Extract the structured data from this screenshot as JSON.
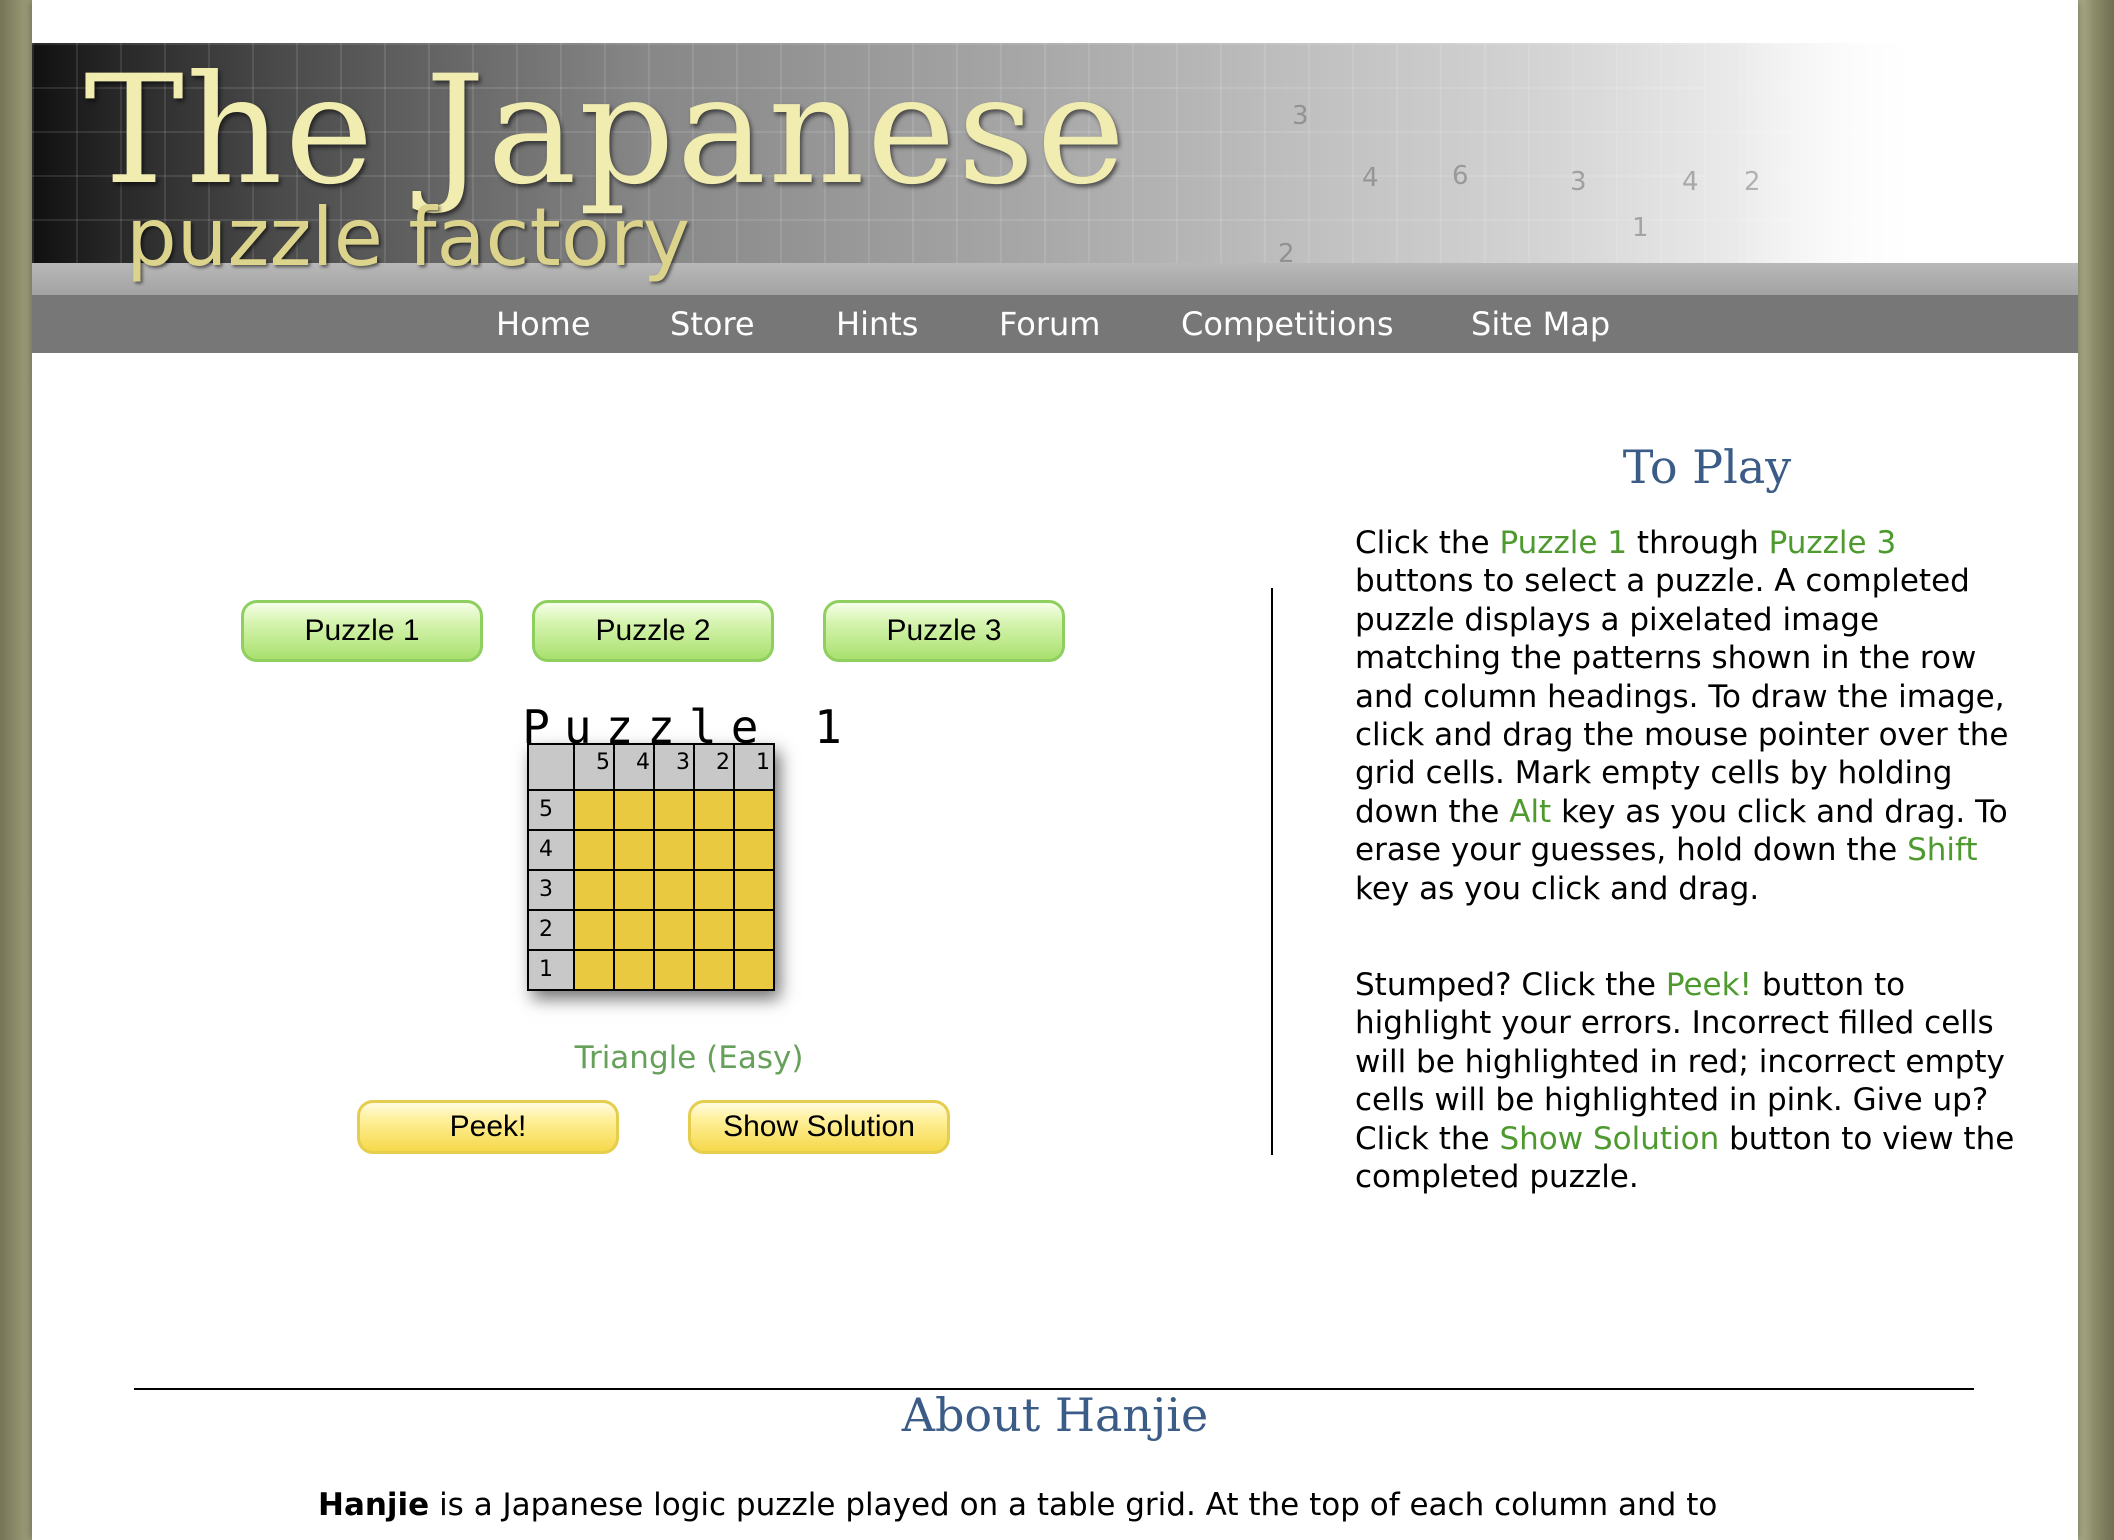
{
  "header": {
    "logo_line1": "The Japanese",
    "logo_line2": "puzzle factory"
  },
  "nav": {
    "items": [
      "Home",
      "Store",
      "Hints",
      "Forum",
      "Competitions",
      "Site Map"
    ]
  },
  "puzzle_buttons": [
    "Puzzle 1",
    "Puzzle 2",
    "Puzzle 3"
  ],
  "puzzle": {
    "title": "Puzzle 1",
    "column_clues": [
      "5",
      "4",
      "3",
      "2",
      "1"
    ],
    "row_clues": [
      "5",
      "4",
      "3",
      "2",
      "1"
    ],
    "cell_color": "#e8c93f",
    "caption": "Triangle (Easy)"
  },
  "actions": {
    "peek_label": "Peek!",
    "solution_label": "Show Solution"
  },
  "to_play": {
    "heading": "To Play",
    "p1": {
      "t1": "Click the ",
      "h1": "Puzzle 1",
      "t2": " through ",
      "h2": "Puzzle 3",
      "t3": " buttons to select a puzzle. A completed puzzle displays a pixelated image matching the patterns shown in the row and column headings. To draw the image, click and drag the mouse pointer over the grid cells. Mark empty cells by holding down the ",
      "h3": "Alt",
      "t4": " key as you click and drag. To erase your guesses, hold down the ",
      "h4": "Shift",
      "t5": " key as you click and drag."
    },
    "p2": {
      "t1": "Stumped? Click the ",
      "h1": "Peek!",
      "t2": " button to highlight your errors. Incorrect filled cells will be highlighted in red; incorrect empty cells will be highlighted in pink. Give up? Click the ",
      "h2": "Show Solution",
      "t3": " button to view the completed puzzle."
    }
  },
  "about": {
    "heading": "About Hanjie",
    "bold_term": "Hanjie",
    "text": " is a Japanese logic puzzle played on a table grid. At the top of each column and to"
  },
  "colors": {
    "nav_bg": "#777777",
    "heading_blue": "#3b5c86",
    "highlight_green": "#4e9a2f",
    "caption_green": "#66a05a",
    "button_green": "#a9e06e",
    "button_yellow": "#f5d84a"
  }
}
